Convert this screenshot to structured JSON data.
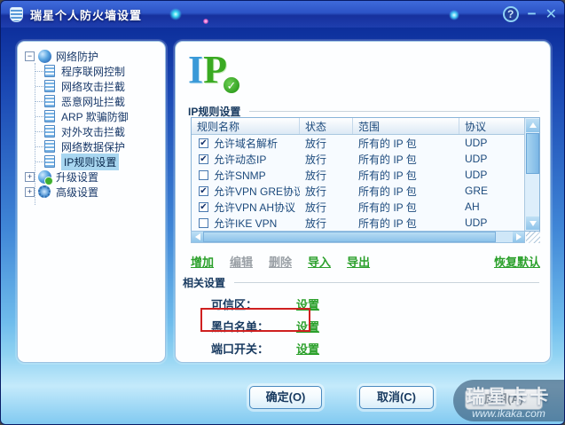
{
  "window": {
    "title": "瑞星个人防火墙设置",
    "controls": {
      "help": "?",
      "minimize": "−",
      "close": "✕"
    }
  },
  "sidebar": {
    "root": {
      "label": "网络防护"
    },
    "children": [
      {
        "label": "程序联网控制"
      },
      {
        "label": "网络攻击拦截"
      },
      {
        "label": "恶意网址拦截"
      },
      {
        "label": "ARP 欺骗防御"
      },
      {
        "label": "对外攻击拦截"
      },
      {
        "label": "网络数据保护"
      },
      {
        "label": "IP规则设置"
      }
    ],
    "groups": [
      {
        "label": "升级设置"
      },
      {
        "label": "高级设置"
      }
    ]
  },
  "main": {
    "logo": {
      "i": "I",
      "p": "P",
      "badge_check": "✓"
    },
    "heading": "IP规则设置",
    "table": {
      "columns": [
        "规则名称",
        "状态",
        "范围",
        "协议"
      ],
      "rows": [
        {
          "check": "✔",
          "name": "允许域名解析",
          "status": "放行",
          "scope": "所有的 IP 包",
          "protocol": "UDP"
        },
        {
          "check": "✔",
          "name": "允许动态IP",
          "status": "放行",
          "scope": "所有的 IP 包",
          "protocol": "UDP"
        },
        {
          "check": "",
          "name": "允许SNMP",
          "status": "放行",
          "scope": "所有的 IP 包",
          "protocol": "UDP"
        },
        {
          "check": "✔",
          "name": "允许VPN GRE协议",
          "status": "放行",
          "scope": "所有的 IP 包",
          "protocol": "GRE"
        },
        {
          "check": "✔",
          "name": "允许VPN AH协议",
          "status": "放行",
          "scope": "所有的 IP 包",
          "protocol": "AH"
        },
        {
          "check": "",
          "name": "允许IKE VPN",
          "status": "放行",
          "scope": "所有的 IP 包",
          "protocol": "UDP"
        }
      ]
    },
    "actions": {
      "add": "增加",
      "edit": "编辑",
      "delete": "删除",
      "import": "导入",
      "export": "导出",
      "restore": "恢复默认"
    },
    "related": {
      "heading": "相关设置",
      "items": [
        {
          "label": "可信区：",
          "link": "设置"
        },
        {
          "label": "黑白名单：",
          "link": "设置"
        },
        {
          "label": "端口开关：",
          "link": "设置"
        }
      ]
    }
  },
  "footer": {
    "ok": "确定(O)",
    "cancel": "取消(C)",
    "apply": "应用(A)"
  },
  "watermark": {
    "brand": "瑞星卡卡",
    "url": "www.ikaka.com"
  },
  "colors": {
    "link_green": "#2ba02b",
    "disabled_gray": "#9aa0a6",
    "annotation_red": "#cf2020",
    "selection_blue": "#a8d6f0",
    "titlebar_blue": "#2a52c4"
  }
}
